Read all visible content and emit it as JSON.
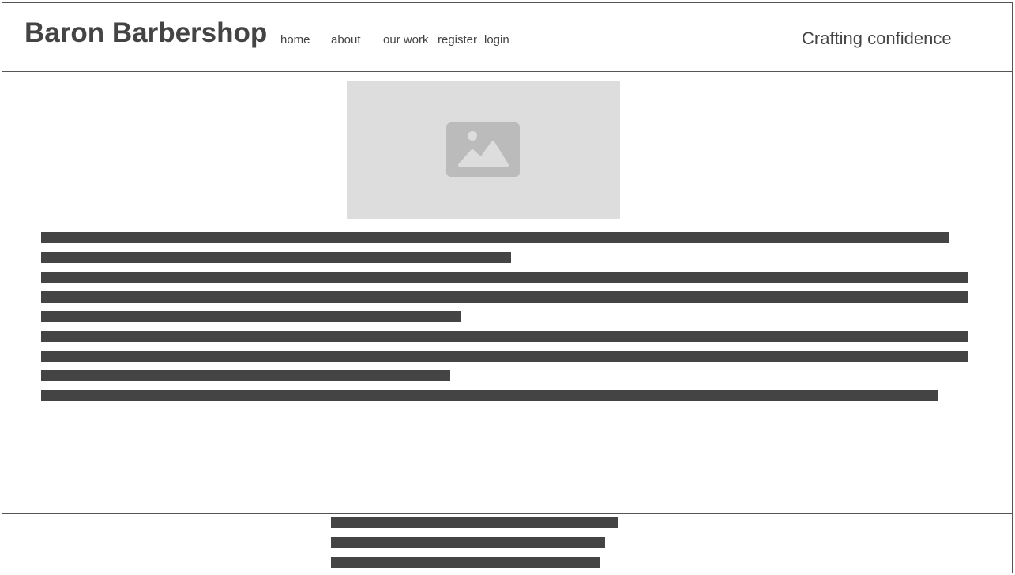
{
  "header": {
    "brand": "Baron Barbershop",
    "tagline": "Crafting confidence",
    "nav": [
      {
        "label": "home"
      },
      {
        "label": "about"
      },
      {
        "label": "our work"
      },
      {
        "label": "register"
      },
      {
        "label": "login"
      }
    ]
  },
  "main": {
    "hero_image_icon": "image-placeholder-icon"
  },
  "colors": {
    "text": "#444444",
    "placeholder_bar": "#444444",
    "image_placeholder_bg": "#dddddd",
    "image_icon": "#bbbbbb",
    "border": "#555555"
  }
}
